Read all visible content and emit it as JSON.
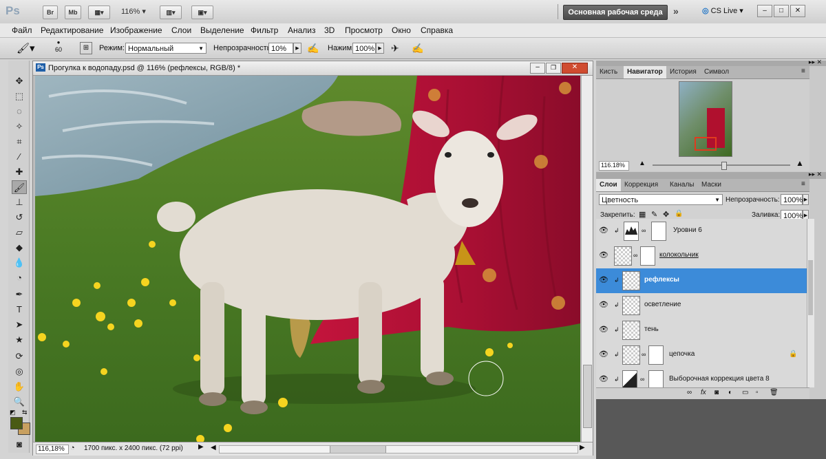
{
  "appbar": {
    "logo": "Ps",
    "btn_br": "Br",
    "btn_mb": "Mb",
    "zoom": "116%",
    "workspace": "Основная рабочая среда",
    "cslive": "CS Live"
  },
  "menu": [
    "Файл",
    "Редактирование",
    "Изображение",
    "Слои",
    "Выделение",
    "Фильтр",
    "Анализ",
    "3D",
    "Просмотр",
    "Окно",
    "Справка"
  ],
  "options": {
    "brush_size": "60",
    "mode_label": "Режим:",
    "mode_value": "Нормальный",
    "opacity_label": "Непрозрачность:",
    "opacity_value": "10%",
    "flow_label": "Нажим:",
    "flow_value": "100%"
  },
  "document": {
    "title": "Прогулка к водопаду.psd @ 116% (рефлексы, RGB/8) *",
    "zoom": "116,18%",
    "info": "1700 пикс. x 2400 пикс. (72 ppi)"
  },
  "navigator": {
    "tabs": [
      "Кисть",
      "Навигатор",
      "История",
      "Символ"
    ],
    "active_tab": "Навигатор",
    "zoom": "116.18%"
  },
  "layers": {
    "tabs": [
      "Слои",
      "Коррекция",
      "Каналы",
      "Маски"
    ],
    "blend_mode": "Цветность",
    "opacity_label": "Непрозрачность:",
    "opacity_value": "100%",
    "lock_label": "Закрепить:",
    "fill_label": "Заливка:",
    "fill_value": "100%",
    "items": [
      {
        "name": "Уровни 6",
        "selected": false
      },
      {
        "name": "колокольчик",
        "selected": false
      },
      {
        "name": "рефлексы",
        "selected": true
      },
      {
        "name": "осветление",
        "selected": false
      },
      {
        "name": "тень",
        "selected": false
      },
      {
        "name": "цепочка",
        "selected": false
      },
      {
        "name": "Выборочная коррекция цвета 8",
        "selected": false
      }
    ]
  },
  "colors": {
    "foreground": "#4a5a14",
    "background": "#c8a060",
    "selection": "#3c8bd9"
  }
}
